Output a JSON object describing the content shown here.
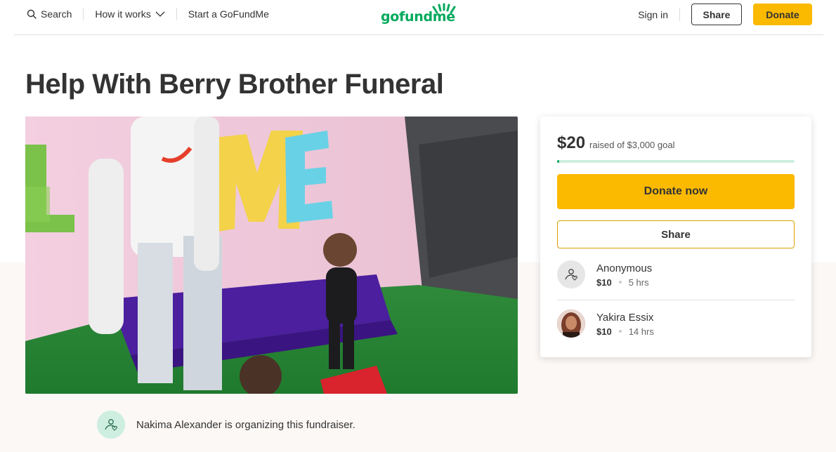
{
  "header": {
    "search_label": "Search",
    "how_it_works_label": "How it works",
    "start_label": "Start a GoFundMe",
    "logo_text": "gofundme",
    "signin_label": "Sign in",
    "share_label": "Share",
    "donate_label": "Donate"
  },
  "campaign": {
    "title": "Help With Berry Brother Funeral",
    "organizer_text": "Nakima Alexander is organizing this fundraiser."
  },
  "donation_card": {
    "raised": "$20",
    "goal_text": "raised of $3,000 goal",
    "progress_fraction": 0.0067,
    "donate_now_label": "Donate now",
    "share_label": "Share",
    "donors": [
      {
        "name": "Anonymous",
        "amount": "$10",
        "time": "5 hrs"
      },
      {
        "name": "Yakira Essix",
        "amount": "$10",
        "time": "14 hrs"
      }
    ]
  },
  "colors": {
    "brand_green": "#02a95c",
    "donate_yellow": "#fbb900",
    "text_dark": "#333333"
  },
  "icons": [
    "search-icon",
    "chevron-down-icon",
    "gofundme-logo",
    "heart-hand-icon"
  ]
}
